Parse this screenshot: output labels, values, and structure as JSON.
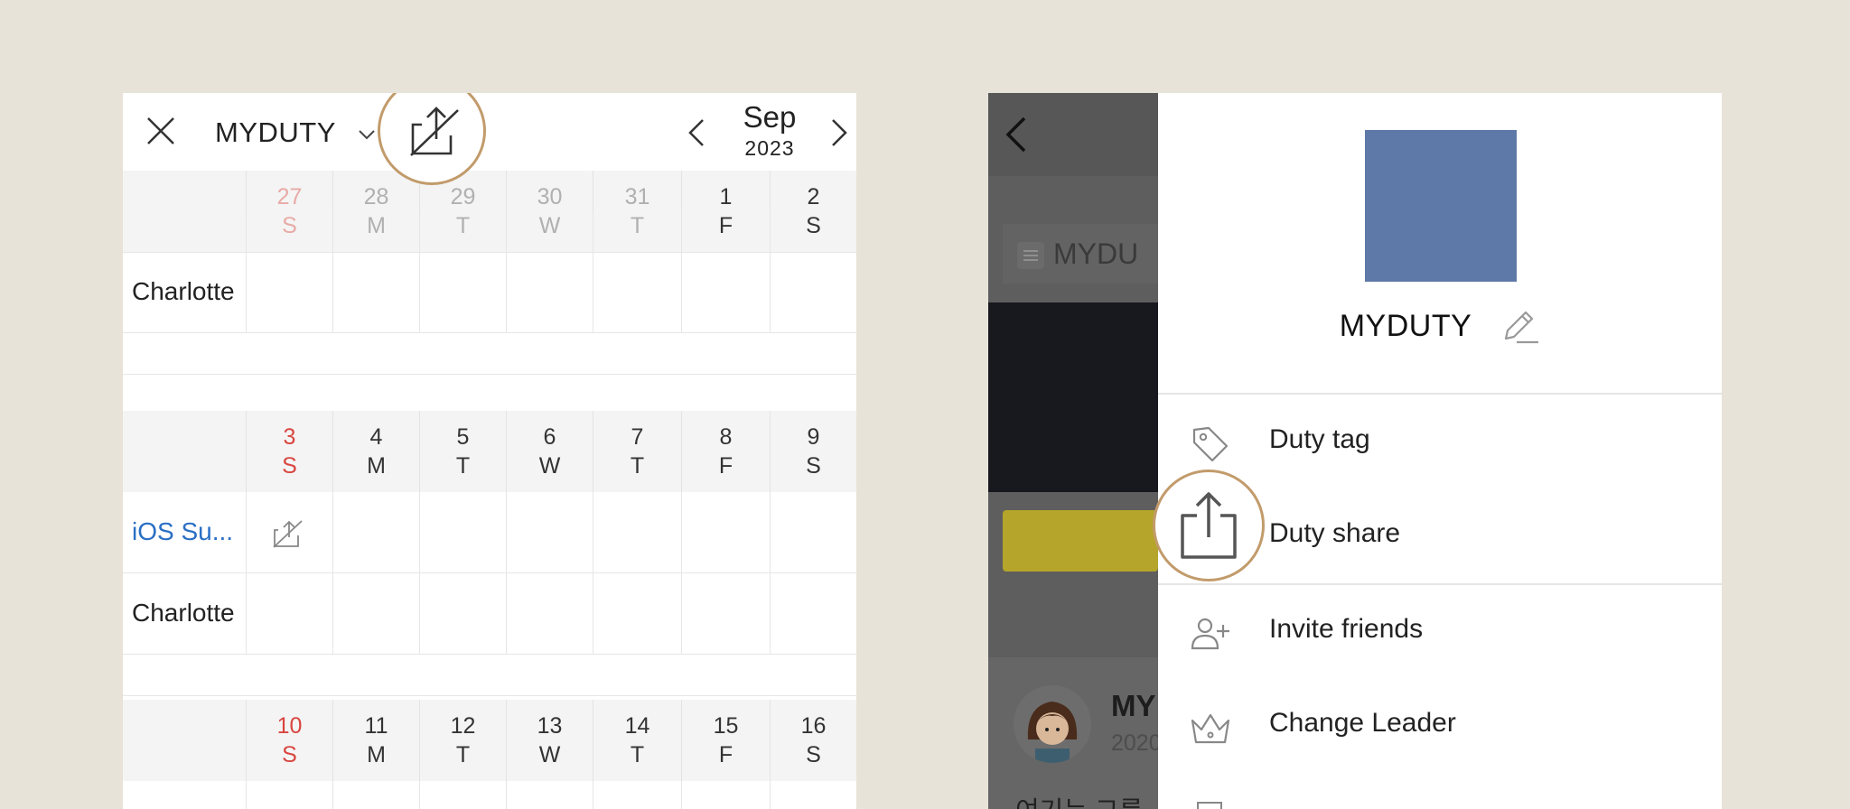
{
  "left_panel": {
    "team_name": "MYDUTY",
    "month": "Sep",
    "year": "2023",
    "weeks": [
      {
        "days": [
          {
            "num": "27",
            "wd": "S",
            "style": "sun-dim"
          },
          {
            "num": "28",
            "wd": "M",
            "style": "dim"
          },
          {
            "num": "29",
            "wd": "T",
            "style": "dim"
          },
          {
            "num": "30",
            "wd": "W",
            "style": "dim"
          },
          {
            "num": "31",
            "wd": "T",
            "style": "dim"
          },
          {
            "num": "1",
            "wd": "F",
            "style": "norm"
          },
          {
            "num": "2",
            "wd": "S",
            "style": "norm"
          }
        ],
        "rows": [
          {
            "name": "Charlotte"
          }
        ]
      },
      {
        "days": [
          {
            "num": "3",
            "wd": "S",
            "style": "sun"
          },
          {
            "num": "4",
            "wd": "M",
            "style": "norm"
          },
          {
            "num": "5",
            "wd": "T",
            "style": "norm"
          },
          {
            "num": "6",
            "wd": "W",
            "style": "norm"
          },
          {
            "num": "7",
            "wd": "T",
            "style": "norm"
          },
          {
            "num": "8",
            "wd": "F",
            "style": "norm"
          },
          {
            "num": "9",
            "wd": "S",
            "style": "norm"
          }
        ],
        "rows": [
          {
            "name": "iOS Su..."
          },
          {
            "name": "Charlotte"
          }
        ]
      },
      {
        "days": [
          {
            "num": "10",
            "wd": "S",
            "style": "sun"
          },
          {
            "num": "11",
            "wd": "M",
            "style": "norm"
          },
          {
            "num": "12",
            "wd": "T",
            "style": "norm"
          },
          {
            "num": "13",
            "wd": "W",
            "style": "norm"
          },
          {
            "num": "14",
            "wd": "T",
            "style": "norm"
          },
          {
            "num": "15",
            "wd": "F",
            "style": "norm"
          },
          {
            "num": "16",
            "wd": "S",
            "style": "norm"
          }
        ]
      }
    ]
  },
  "right_panel": {
    "background": {
      "title": "MYDU",
      "post_author": "MY",
      "post_date": "2020",
      "post_text": "여기는 그룹"
    },
    "sheet": {
      "team_name": "MYDUTY",
      "team_image_color": "#5e79a7",
      "menu": [
        {
          "label": "Duty tag",
          "icon": "tag-icon"
        },
        {
          "label": "Duty share",
          "icon": "share-icon"
        },
        {
          "label": "Invite friends",
          "icon": "add-user-icon"
        },
        {
          "label": "Change Leader",
          "icon": "crown-icon"
        }
      ]
    }
  },
  "colors": {
    "background": "#e7e3d8",
    "highlight_ring": "#c29b6b",
    "sunday": "#d9453f",
    "link_blue": "#2a6fc4"
  }
}
